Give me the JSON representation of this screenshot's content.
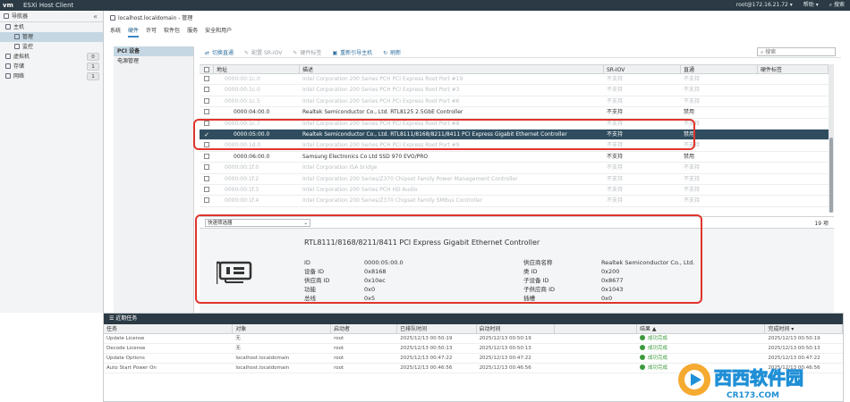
{
  "header": {
    "logo": "vm",
    "title": "ESXi Host Client",
    "user": "root@172.16.21.72 ▾",
    "help": "帮助 ▾",
    "search": "搜索"
  },
  "navigator": {
    "title": "导航器",
    "collapse": "«",
    "items": [
      {
        "label": "主机",
        "level": 0,
        "selected": false
      },
      {
        "label": "管理",
        "level": 1,
        "selected": true
      },
      {
        "label": "监控",
        "level": 1,
        "selected": false
      },
      {
        "label": "虚拟机",
        "level": 0,
        "badge": "0"
      },
      {
        "label": "存储",
        "level": 0,
        "badge": "1"
      },
      {
        "label": "网络",
        "level": 0,
        "badge": "1"
      }
    ]
  },
  "breadcrumb": "localhost.localdomain - 管理",
  "tabs": [
    {
      "label": "系统",
      "active": false
    },
    {
      "label": "硬件",
      "active": true
    },
    {
      "label": "许可",
      "active": false
    },
    {
      "label": "软件包",
      "active": false
    },
    {
      "label": "服务",
      "active": false
    },
    {
      "label": "安全和用户",
      "active": false
    }
  ],
  "subnav": [
    {
      "label": "PCI 设备",
      "selected": true
    },
    {
      "label": "电源管理",
      "selected": false
    }
  ],
  "toolbar": {
    "toggle": "切换直通",
    "config": "配置 SR-IOV",
    "hwlabel": "硬件标签",
    "reboot": "重新引导主机",
    "refresh": "刷新",
    "search_placeholder": "搜索"
  },
  "grid": {
    "columns": [
      "地址",
      "描述",
      "SR-IOV",
      "直通",
      "硬件标签"
    ],
    "rows": [
      {
        "addr": "0000:00:1c.0",
        "desc": "Intel Corporation 200 Series PCH PCI Express Root Port #19",
        "sriov": "不支持",
        "pass": "不支持",
        "state": "dim"
      },
      {
        "addr": "0000:00:1c.0",
        "desc": "Intel Corporation 200 Series PCH PCI Express Root Port #3",
        "sriov": "不支持",
        "pass": "不支持",
        "state": "dim"
      },
      {
        "addr": "0000:00:1c.5",
        "desc": "Intel Corporation 200 Series PCH PCI Express Root Port #6",
        "sriov": "不支持",
        "pass": "不支持",
        "state": "dim"
      },
      {
        "addr": "0000:04:00.0",
        "desc": "Realtek Semiconductor Co., Ltd. RTL8125 2.5GbE Controller",
        "sriov": "不支持",
        "pass": "禁用",
        "state": "normal"
      },
      {
        "addr": "0000:00:1c.7",
        "desc": "Intel Corporation 200 Series PCH PCI Express Root Port #8",
        "sriov": "不支持",
        "pass": "不支持",
        "state": "dim"
      },
      {
        "addr": "0000:05:00.0",
        "desc": "Realtek Semiconductor Co., Ltd. RTL8111/8168/8211/8411 PCI Express Gigabit Ethernet Controller",
        "sriov": "不支持",
        "pass": "禁用",
        "state": "sel"
      },
      {
        "addr": "0000:00:1d.0",
        "desc": "Intel Corporation 200 Series PCH PCI Express Root Port #9",
        "sriov": "不支持",
        "pass": "不支持",
        "state": "dim"
      },
      {
        "addr": "0000:06:00.0",
        "desc": "Samsung Electronics Co Ltd SSD 970 EVO/PRO",
        "sriov": "不支持",
        "pass": "禁用",
        "state": "normal"
      },
      {
        "addr": "0000:00:1f.0",
        "desc": "Intel Corporation ISA bridge",
        "sriov": "不支持",
        "pass": "不支持",
        "state": "dim"
      },
      {
        "addr": "0000:00:1f.2",
        "desc": "Intel Corporation 200 Series/Z370 Chipset Family Power Management Controller",
        "sriov": "不支持",
        "pass": "不支持",
        "state": "dim"
      },
      {
        "addr": "0000:00:1f.3",
        "desc": "Intel Corporation 200 Series PCH HD Audio",
        "sriov": "不支持",
        "pass": "不支持",
        "state": "dim"
      },
      {
        "addr": "0000:00:1f.4",
        "desc": "Intel Corporation 200 Series/Z370 Chipset Family SMBus Controller",
        "sriov": "不支持",
        "pass": "不支持",
        "state": "dim"
      }
    ],
    "filter": "快速筛选器",
    "count": "19 项"
  },
  "detail": {
    "title": "RTL8111/8168/8211/8411 PCI Express Gigabit Ethernet Controller",
    "left": [
      {
        "k": "ID",
        "v": "0000:05:00.0"
      },
      {
        "k": "设备 ID",
        "v": "0x8168"
      },
      {
        "k": "供应商 ID",
        "v": "0x10ec"
      },
      {
        "k": "功能",
        "v": "0x0"
      },
      {
        "k": "总线",
        "v": "0x5"
      }
    ],
    "right": [
      {
        "k": "供应商名称",
        "v": "Realtek Semiconductor Co., Ltd."
      },
      {
        "k": "类 ID",
        "v": "0x200"
      },
      {
        "k": "子设备 ID",
        "v": "0x8677"
      },
      {
        "k": "子供应商 ID",
        "v": "0x1043"
      },
      {
        "k": "插槽",
        "v": "0x0"
      }
    ]
  },
  "tasks": {
    "title": "近期任务",
    "columns": [
      "任务",
      "对象",
      "启动者",
      "已排队时间",
      "启动时间",
      "结果 ▲",
      "完成时间 ▾"
    ],
    "rows": [
      {
        "task": "Update License",
        "target": "无",
        "initiator": "root",
        "queued": "2025/12/13 00:50:19",
        "started": "2025/12/13 00:50:19",
        "result": "成功完成",
        "completed": "2025/12/13 00:50:19"
      },
      {
        "task": "Decode License",
        "target": "无",
        "initiator": "root",
        "queued": "2025/12/13 00:50:13",
        "started": "2025/12/13 00:50:13",
        "result": "成功完成",
        "completed": "2025/12/13 00:50:13"
      },
      {
        "task": "Update Options",
        "target": "localhost.localdomain",
        "initiator": "root",
        "queued": "2025/12/13 00:47:22",
        "started": "2025/12/13 00:47:22",
        "result": "成功完成",
        "completed": "2025/12/13 00:47:22"
      },
      {
        "task": "Auto Start Power On",
        "target": "localhost.localdomain",
        "initiator": "root",
        "queued": "2025/12/13 00:46:56",
        "started": "2025/12/13 00:46:56",
        "result": "成功完成",
        "completed": "2025/12/13 00:46:56"
      }
    ]
  },
  "watermark": {
    "text": "西西软件园",
    "sub": "CR173.COM"
  },
  "colors": {
    "highlight": "#e0352b",
    "selected_row": "#2f4d5f",
    "topbar": "#2b3a44",
    "success": "#3a9a3a"
  }
}
